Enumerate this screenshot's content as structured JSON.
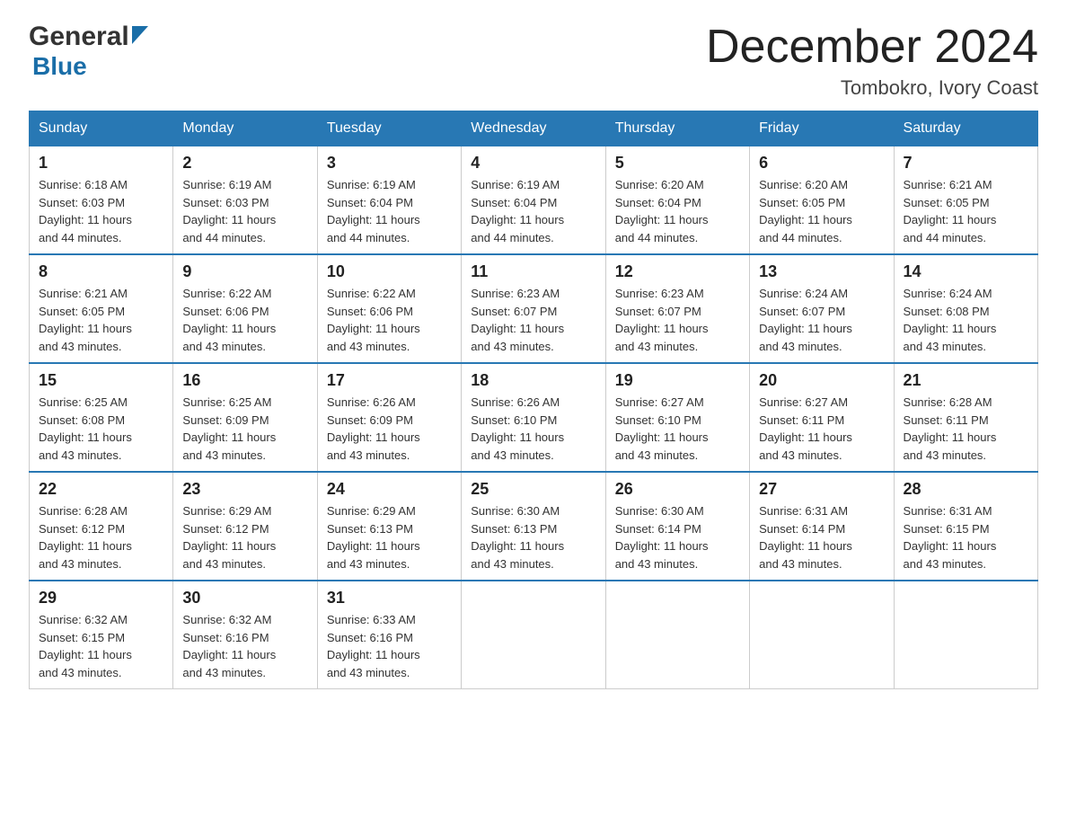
{
  "header": {
    "logo_general": "General",
    "logo_blue": "Blue",
    "main_title": "December 2024",
    "subtitle": "Tombokro, Ivory Coast"
  },
  "days_of_week": [
    "Sunday",
    "Monday",
    "Tuesday",
    "Wednesday",
    "Thursday",
    "Friday",
    "Saturday"
  ],
  "weeks": [
    [
      {
        "num": "1",
        "sunrise": "6:18 AM",
        "sunset": "6:03 PM",
        "daylight": "11 hours and 44 minutes."
      },
      {
        "num": "2",
        "sunrise": "6:19 AM",
        "sunset": "6:03 PM",
        "daylight": "11 hours and 44 minutes."
      },
      {
        "num": "3",
        "sunrise": "6:19 AM",
        "sunset": "6:04 PM",
        "daylight": "11 hours and 44 minutes."
      },
      {
        "num": "4",
        "sunrise": "6:19 AM",
        "sunset": "6:04 PM",
        "daylight": "11 hours and 44 minutes."
      },
      {
        "num": "5",
        "sunrise": "6:20 AM",
        "sunset": "6:04 PM",
        "daylight": "11 hours and 44 minutes."
      },
      {
        "num": "6",
        "sunrise": "6:20 AM",
        "sunset": "6:05 PM",
        "daylight": "11 hours and 44 minutes."
      },
      {
        "num": "7",
        "sunrise": "6:21 AM",
        "sunset": "6:05 PM",
        "daylight": "11 hours and 44 minutes."
      }
    ],
    [
      {
        "num": "8",
        "sunrise": "6:21 AM",
        "sunset": "6:05 PM",
        "daylight": "11 hours and 43 minutes."
      },
      {
        "num": "9",
        "sunrise": "6:22 AM",
        "sunset": "6:06 PM",
        "daylight": "11 hours and 43 minutes."
      },
      {
        "num": "10",
        "sunrise": "6:22 AM",
        "sunset": "6:06 PM",
        "daylight": "11 hours and 43 minutes."
      },
      {
        "num": "11",
        "sunrise": "6:23 AM",
        "sunset": "6:07 PM",
        "daylight": "11 hours and 43 minutes."
      },
      {
        "num": "12",
        "sunrise": "6:23 AM",
        "sunset": "6:07 PM",
        "daylight": "11 hours and 43 minutes."
      },
      {
        "num": "13",
        "sunrise": "6:24 AM",
        "sunset": "6:07 PM",
        "daylight": "11 hours and 43 minutes."
      },
      {
        "num": "14",
        "sunrise": "6:24 AM",
        "sunset": "6:08 PM",
        "daylight": "11 hours and 43 minutes."
      }
    ],
    [
      {
        "num": "15",
        "sunrise": "6:25 AM",
        "sunset": "6:08 PM",
        "daylight": "11 hours and 43 minutes."
      },
      {
        "num": "16",
        "sunrise": "6:25 AM",
        "sunset": "6:09 PM",
        "daylight": "11 hours and 43 minutes."
      },
      {
        "num": "17",
        "sunrise": "6:26 AM",
        "sunset": "6:09 PM",
        "daylight": "11 hours and 43 minutes."
      },
      {
        "num": "18",
        "sunrise": "6:26 AM",
        "sunset": "6:10 PM",
        "daylight": "11 hours and 43 minutes."
      },
      {
        "num": "19",
        "sunrise": "6:27 AM",
        "sunset": "6:10 PM",
        "daylight": "11 hours and 43 minutes."
      },
      {
        "num": "20",
        "sunrise": "6:27 AM",
        "sunset": "6:11 PM",
        "daylight": "11 hours and 43 minutes."
      },
      {
        "num": "21",
        "sunrise": "6:28 AM",
        "sunset": "6:11 PM",
        "daylight": "11 hours and 43 minutes."
      }
    ],
    [
      {
        "num": "22",
        "sunrise": "6:28 AM",
        "sunset": "6:12 PM",
        "daylight": "11 hours and 43 minutes."
      },
      {
        "num": "23",
        "sunrise": "6:29 AM",
        "sunset": "6:12 PM",
        "daylight": "11 hours and 43 minutes."
      },
      {
        "num": "24",
        "sunrise": "6:29 AM",
        "sunset": "6:13 PM",
        "daylight": "11 hours and 43 minutes."
      },
      {
        "num": "25",
        "sunrise": "6:30 AM",
        "sunset": "6:13 PM",
        "daylight": "11 hours and 43 minutes."
      },
      {
        "num": "26",
        "sunrise": "6:30 AM",
        "sunset": "6:14 PM",
        "daylight": "11 hours and 43 minutes."
      },
      {
        "num": "27",
        "sunrise": "6:31 AM",
        "sunset": "6:14 PM",
        "daylight": "11 hours and 43 minutes."
      },
      {
        "num": "28",
        "sunrise": "6:31 AM",
        "sunset": "6:15 PM",
        "daylight": "11 hours and 43 minutes."
      }
    ],
    [
      {
        "num": "29",
        "sunrise": "6:32 AM",
        "sunset": "6:15 PM",
        "daylight": "11 hours and 43 minutes."
      },
      {
        "num": "30",
        "sunrise": "6:32 AM",
        "sunset": "6:16 PM",
        "daylight": "11 hours and 43 minutes."
      },
      {
        "num": "31",
        "sunrise": "6:33 AM",
        "sunset": "6:16 PM",
        "daylight": "11 hours and 43 minutes."
      },
      null,
      null,
      null,
      null
    ]
  ],
  "labels": {
    "sunrise": "Sunrise:",
    "sunset": "Sunset:",
    "daylight": "Daylight:"
  }
}
